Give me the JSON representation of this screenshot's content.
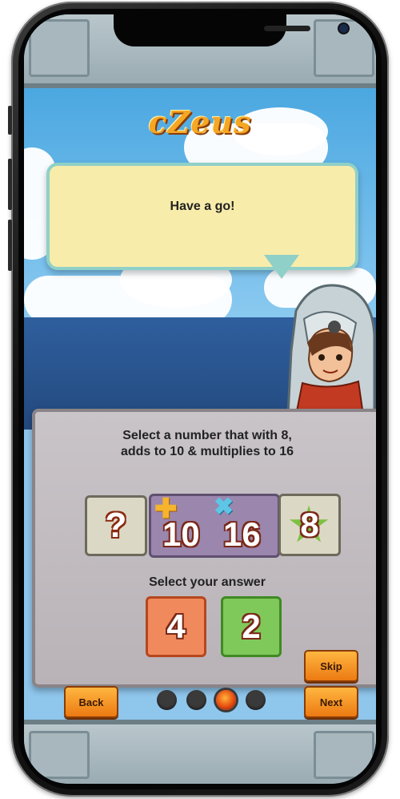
{
  "app": {
    "logo_text": "cZeus"
  },
  "speech": {
    "text": "Have a go!"
  },
  "puzzle": {
    "question_line1": "Select a number that with 8,",
    "question_line2": "adds to 10 & multiplies to 16",
    "unknown_symbol": "?",
    "sum_value": "10",
    "product_value": "16",
    "known_value": "8",
    "answer_prompt": "Select your answer",
    "answers": [
      "4",
      "2"
    ]
  },
  "nav": {
    "skip_label": "Skip",
    "back_label": "Back",
    "next_label": "Next",
    "page_count": 4,
    "active_page": 3
  },
  "colors": {
    "button": "#ec7a12",
    "answer_a": "#f08a5c",
    "answer_b": "#7fc95a",
    "bubble": "#f8ecaa"
  }
}
